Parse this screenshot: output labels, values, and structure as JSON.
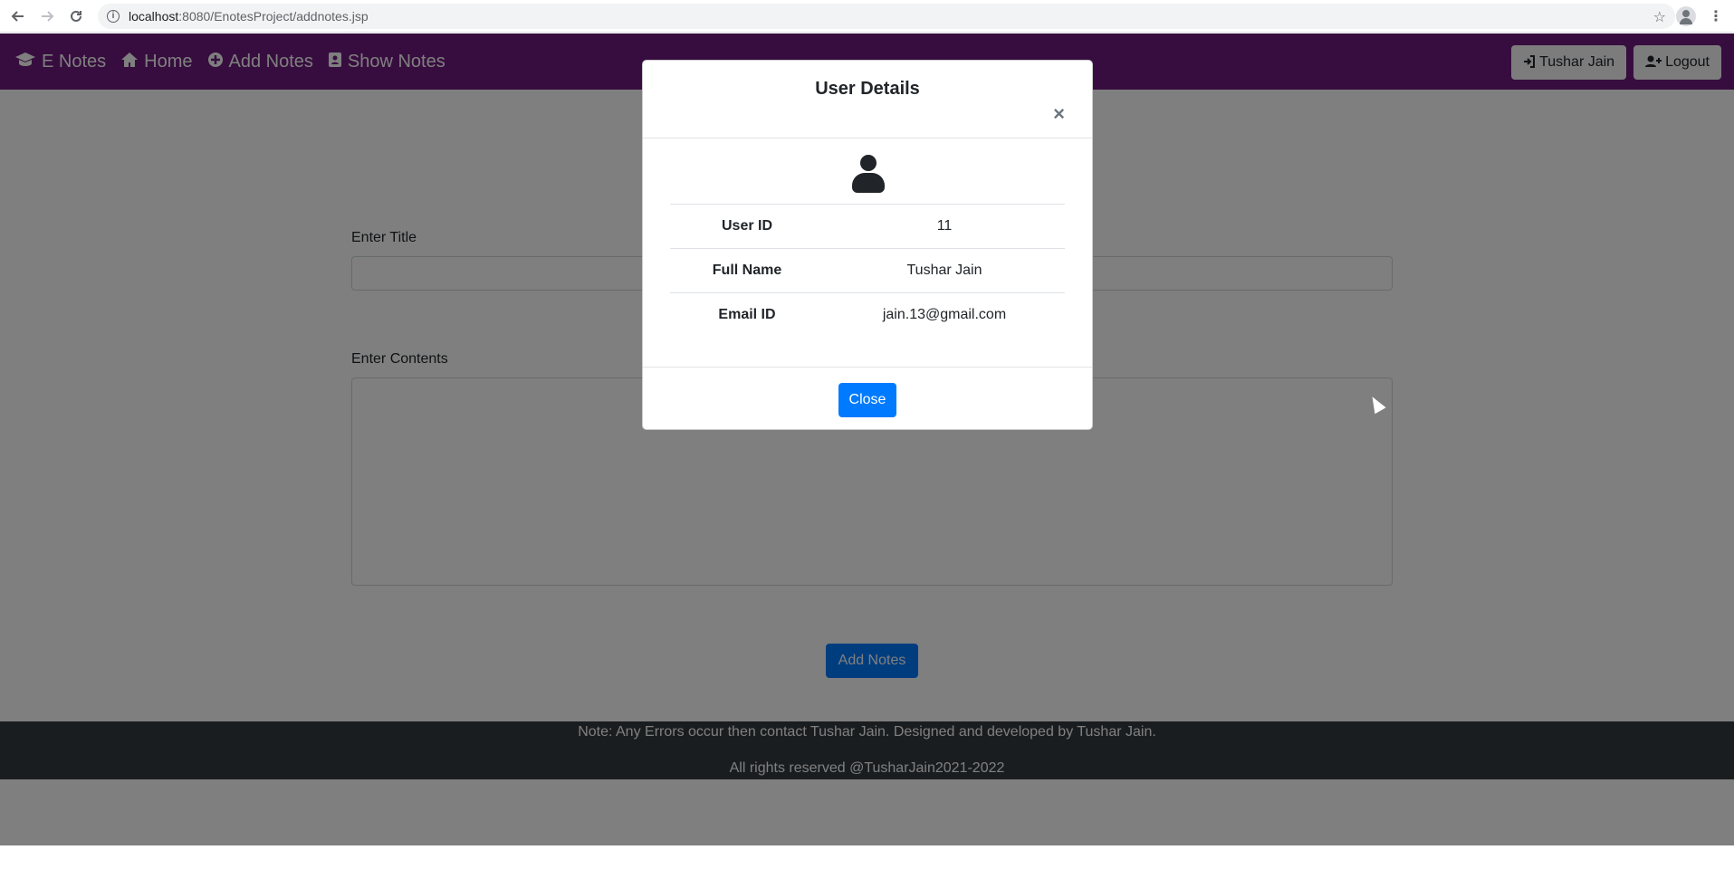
{
  "browser": {
    "url_host": "localhost",
    "url_path": ":8080/EnotesProject/addnotes.jsp"
  },
  "navbar": {
    "brand": "E Notes",
    "items": [
      {
        "label": "Home",
        "icon": "home-icon"
      },
      {
        "label": "Add Notes",
        "icon": "plus-circle-icon"
      },
      {
        "label": "Show Notes",
        "icon": "address-book-icon"
      }
    ],
    "user_button": "Tushar Jain",
    "logout_button": "Logout"
  },
  "form": {
    "title_label": "Enter Title",
    "content_label": "Enter Contents",
    "submit_label": "Add Notes"
  },
  "footer": {
    "line1": "Note: Any Errors occur then contact Tushar Jain. Designed and developed by Tushar Jain.",
    "line2": "All rights reserved @TusharJain2021-2022"
  },
  "modal": {
    "title": "User Details",
    "close_symbol": "×",
    "rows": [
      {
        "key": "User ID",
        "value": "11"
      },
      {
        "key": "Full Name",
        "value": "Tushar Jain"
      },
      {
        "key": "Email ID",
        "value": "jain.13@gmail.com"
      }
    ],
    "close_button": "Close"
  },
  "colors": {
    "navbar": "#6f1a7e",
    "primary": "#007bff",
    "footer": "#343a40"
  }
}
